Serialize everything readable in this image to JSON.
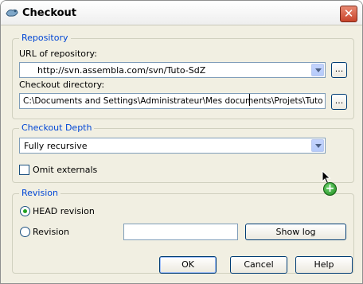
{
  "window": {
    "title": "Checkout",
    "close_label": "✕"
  },
  "repository": {
    "legend": "Repository",
    "url_label": "URL of repository:",
    "url_value": "http://svn.assembla.com/svn/Tuto-SdZ",
    "browse_label": "...",
    "dir_label": "Checkout directory:",
    "dir_value": "C:\\Documents and Settings\\Administrateur\\Mes documents\\Projets\\Tuto SdZ",
    "dir_browse_label": "..."
  },
  "depth": {
    "legend": "Checkout Depth",
    "selected": "Fully recursive",
    "omit_externals_label": "Omit externals",
    "omit_externals_checked": false
  },
  "revision": {
    "legend": "Revision",
    "head_label": "HEAD revision",
    "head_selected": true,
    "revision_label": "Revision",
    "revision_value": "",
    "show_log_label": "Show log"
  },
  "buttons": {
    "ok": "OK",
    "cancel": "Cancel",
    "help": "Help"
  },
  "overlay": {
    "add_badge": "+"
  }
}
